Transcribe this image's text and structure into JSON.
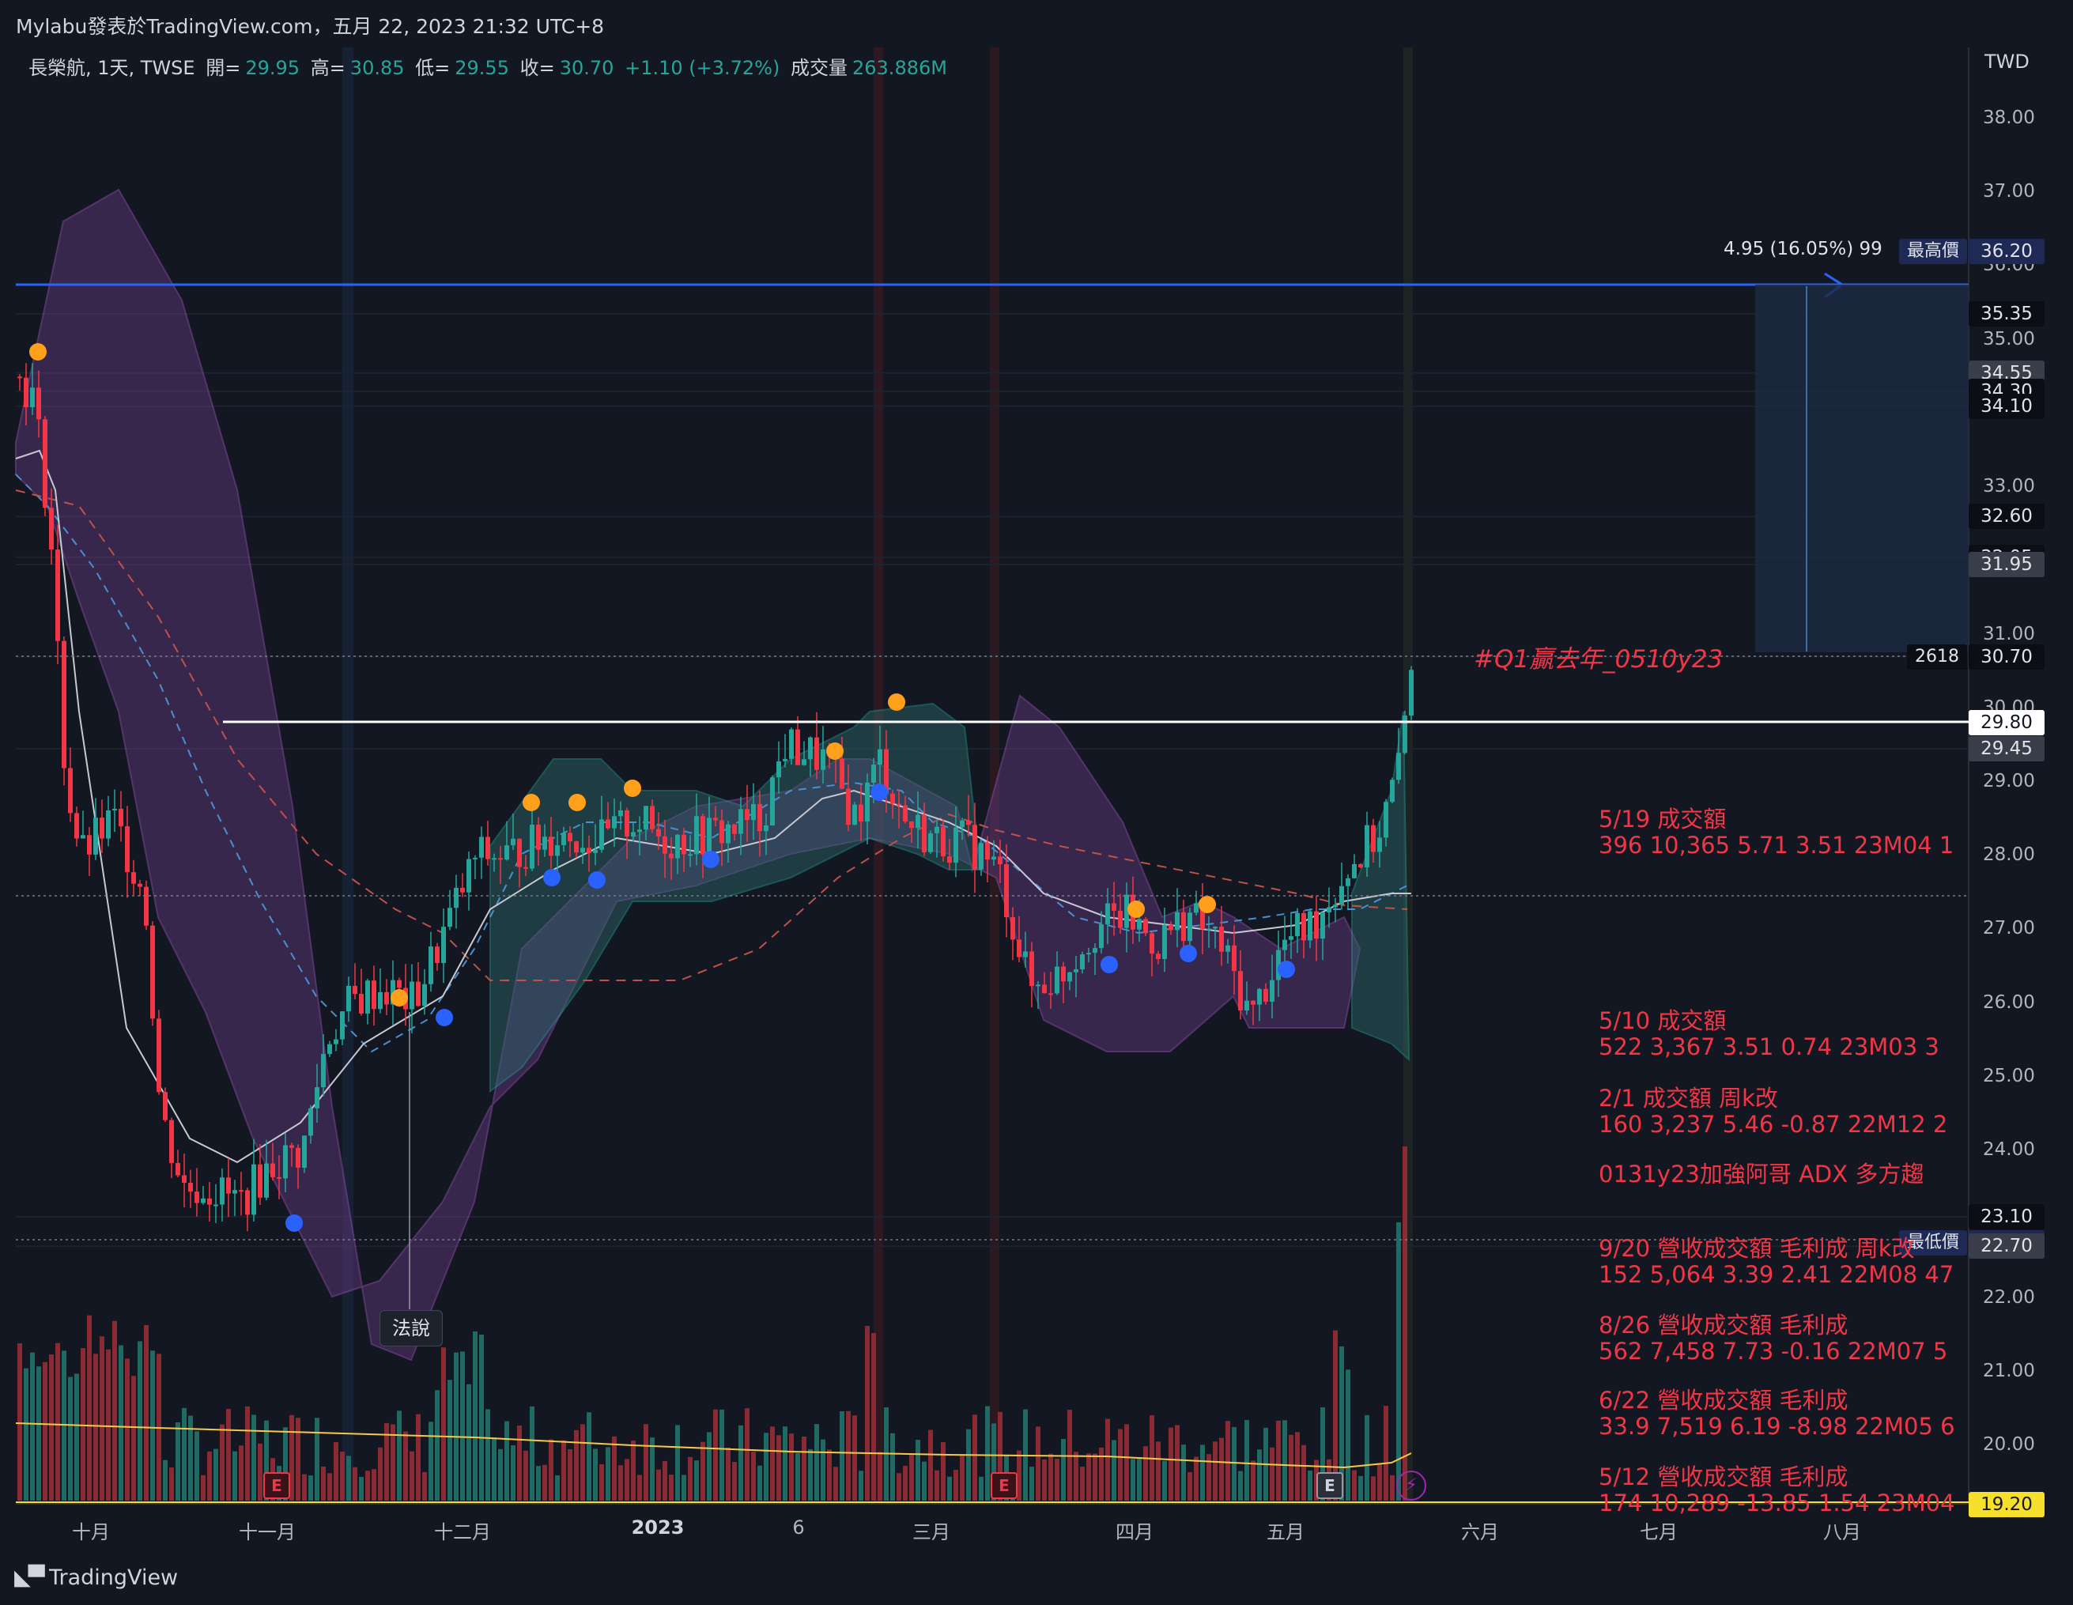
{
  "header": {
    "published": "Mylabu發表於TradingView.com，五月 22, 2023 21:32 UTC+8"
  },
  "legend": {
    "symbol": "長榮航, 1天, TWSE",
    "open_label": "開=",
    "open": "29.95",
    "high_label": "高=",
    "high": "30.85",
    "low_label": "低=",
    "low": "29.55",
    "close_label": "收=",
    "close": "30.70",
    "change": "+1.10 (+3.72%)",
    "volume_label": "成交量",
    "volume": "263.886M"
  },
  "price_axis": {
    "currency": "TWD",
    "ticks": [
      "38.00",
      "37.00",
      "36.00",
      "35.00",
      "33.00",
      "31.00",
      "30.00",
      "29.00",
      "28.00",
      "27.00",
      "26.00",
      "25.00",
      "24.00",
      "22.00",
      "21.00",
      "20.00"
    ],
    "labels": [
      {
        "text": "36.20",
        "style": "navy",
        "tag": "最高價",
        "price": 36.2
      },
      {
        "text": "35.35",
        "style": "dark",
        "price": 35.35
      },
      {
        "text": "34.55",
        "style": "gray",
        "price": 34.55
      },
      {
        "text": "34.30",
        "style": "dark",
        "price": 34.3
      },
      {
        "text": "34.10",
        "style": "dark",
        "price": 34.1
      },
      {
        "text": "32.60",
        "style": "dark",
        "price": 32.6
      },
      {
        "text": "32.05",
        "style": "dark",
        "price": 32.05
      },
      {
        "text": "31.95",
        "style": "gray",
        "price": 31.95
      },
      {
        "text": "30.70",
        "style": "dark",
        "tag": "2618",
        "price": 30.7
      },
      {
        "text": "29.80",
        "style": "white",
        "price": 29.8
      },
      {
        "text": "29.45",
        "style": "gray",
        "price": 29.45
      },
      {
        "text": "23.10",
        "style": "dark",
        "price": 23.1
      },
      {
        "text": "22.75",
        "style": "navy",
        "tag": "最低價",
        "price": 22.75
      },
      {
        "text": "22.70",
        "style": "gray",
        "price": 22.7
      },
      {
        "text": "19.20",
        "style": "yellow",
        "price": 19.2
      }
    ]
  },
  "time_axis": {
    "ticks": [
      {
        "text": "十月",
        "bold": false
      },
      {
        "text": "十一月",
        "bold": false
      },
      {
        "text": "十二月",
        "bold": false
      },
      {
        "text": "2023",
        "bold": true
      },
      {
        "text": "6",
        "bold": false
      },
      {
        "text": "三月",
        "bold": false
      },
      {
        "text": "四月",
        "bold": false
      },
      {
        "text": "五月",
        "bold": false
      },
      {
        "text": "六月",
        "bold": false
      },
      {
        "text": "七月",
        "bold": false
      },
      {
        "text": "八月",
        "bold": false
      }
    ]
  },
  "measure": {
    "text": "4.95 (16.05%) 99"
  },
  "hashtag": "#Q1贏去年_0510y23",
  "annotations": [
    {
      "line1": "5/19   成交額",
      "line2": "396 10,365 5.71 3.51 23M04 1"
    },
    {
      "line1": "5/10  成交額",
      "line2": "522 3,367 3.51 0.74 23M03 3"
    },
    {
      "line1": "2/1   成交額  周k改",
      "line2": "160 3,237 5.46 -0.87 22M12 2"
    },
    {
      "line1": "0131y23加強阿哥   ADX 多方趨",
      "line2": ""
    },
    {
      "line1": "9/20  營收成交額  毛利成 周k改",
      "line2": "152 5,064 3.39 2.41 22M08 47"
    },
    {
      "line1": "8/26 營收成交額  毛利成",
      "line2": "562 7,458 7.73 -0.16 22M07 5"
    },
    {
      "line1": "6/22   營收成交額  毛利成",
      "line2": "33.9 7,519 6.19 -8.98 22M05 6"
    },
    {
      "line1": "5/12 營收成交額 毛利成",
      "line2": "174 10,289 -13.85 1.54 23M04"
    }
  ],
  "note_bubble": "法說",
  "badges": [
    "E",
    "E",
    "E"
  ],
  "footer": {
    "brand": "TradingView"
  },
  "colors": {
    "up": "#26a69a",
    "down": "#f23645",
    "bg": "#131722",
    "band_up": "#2a5a5a",
    "band_down": "#5c3a7a",
    "hline_blue": "#2962ff"
  },
  "chart_data": {
    "type": "candlestick",
    "symbol": "長榮航",
    "interval": "1天",
    "ylim": [
      19.2,
      38.6
    ],
    "key_levels": [
      36.2,
      35.35,
      34.55,
      34.3,
      34.1,
      32.6,
      32.05,
      31.95,
      30.7,
      29.8,
      29.45,
      23.1,
      22.75,
      22.7
    ],
    "last": {
      "open": 29.95,
      "high": 30.85,
      "low": 29.55,
      "close": 30.7,
      "volume": "263.886M"
    }
  }
}
